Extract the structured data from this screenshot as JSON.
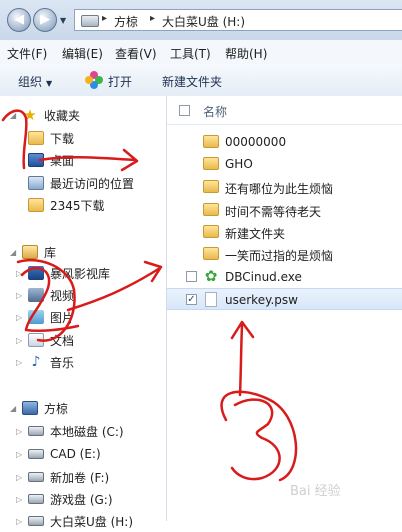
{
  "address": {
    "crumbs": [
      "方椋",
      "大白菜U盘 (H:)"
    ],
    "sep": "▸"
  },
  "menu": [
    "文件(F)",
    "编辑(E)",
    "查看(V)",
    "工具(T)",
    "帮助(H)"
  ],
  "toolbar": {
    "organize": "组织",
    "open": "打开",
    "new_folder": "新建文件夹"
  },
  "nav": {
    "favorites": {
      "label": "收藏夹",
      "items": [
        "下载",
        "桌面",
        "最近访问的位置",
        "2345下载"
      ]
    },
    "libraries": {
      "label": "库",
      "items": [
        "暴风影视库",
        "视频",
        "图片",
        "文档",
        "音乐"
      ]
    },
    "computer": {
      "label": "方椋",
      "items": [
        "本地磁盘 (C:)",
        "CAD (E:)",
        "新加卷 (F:)",
        "游戏盘 (G:)",
        "大白菜U盘 (H:)"
      ]
    }
  },
  "content": {
    "column_name": "名称",
    "files": [
      {
        "name": "00000000",
        "icon": "folder-icon",
        "checked": false
      },
      {
        "name": "GHO",
        "icon": "folder-icon",
        "checked": false
      },
      {
        "name": "还有哪位为此生烦恼",
        "icon": "folder-icon",
        "checked": false
      },
      {
        "name": "时间不需等待老天",
        "icon": "folder-icon",
        "checked": false
      },
      {
        "name": "新建文件夹",
        "icon": "folder-icon",
        "checked": false
      },
      {
        "name": "一笑而过指的是烦恼",
        "icon": "folder-icon",
        "checked": false
      },
      {
        "name": "DBCinud.exe",
        "icon": "exe-icon",
        "checked": false
      },
      {
        "name": "userkey.psw",
        "icon": "file-icon",
        "checked": true
      }
    ]
  },
  "watermark": "Bai 经验",
  "colors": {
    "annotation": "#d81b1b",
    "selection": "#d8e7f9"
  }
}
